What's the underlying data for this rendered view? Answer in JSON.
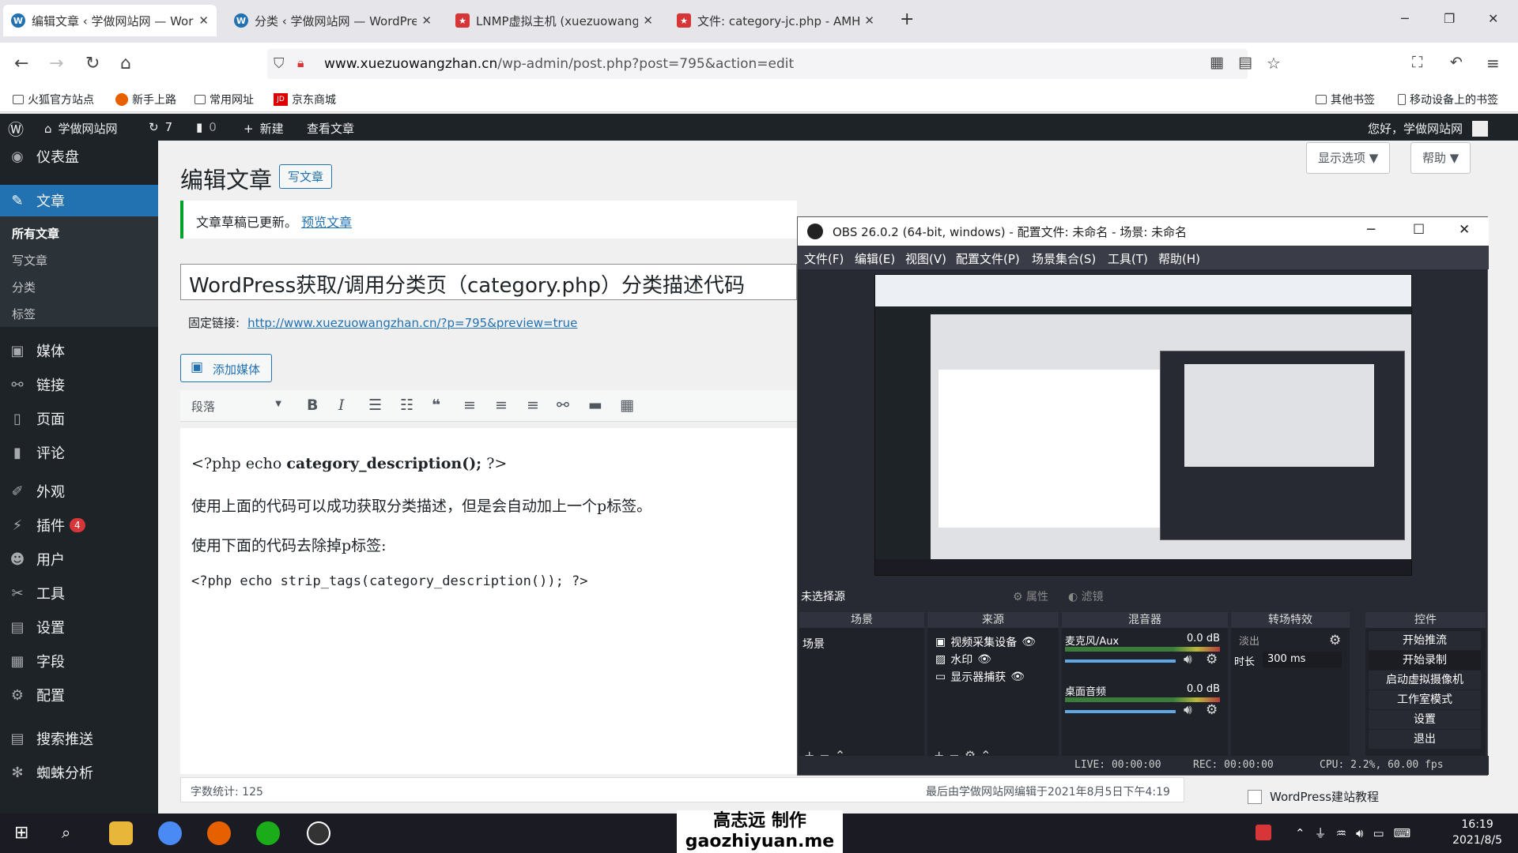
{
  "browser": {
    "tabs": [
      {
        "title": "编辑文章 ‹ 学做网站网 — Wor",
        "favicon": "wordpress-icon",
        "color": "#2271b1"
      },
      {
        "title": "分类 ‹ 学做网站网 — WordPre",
        "favicon": "wordpress-icon",
        "color": "#2271b1"
      },
      {
        "title": "LNMP虚拟主机 (xuezuowang",
        "favicon": "star-icon",
        "color": "#d63638"
      },
      {
        "title": "文件: category-jc.php - AMH",
        "favicon": "star-icon",
        "color": "#d63638"
      }
    ],
    "new_tab": "+",
    "url_domain": "www.xuezuowangzhan.cn",
    "url_path": "/wp-admin/post.php?post=795&action=edit",
    "bookmarks": [
      "火狐官方站点",
      "新手上路",
      "常用网址",
      "京东商城"
    ],
    "bookmarks_right": [
      "其他书签",
      "移动设备上的书签"
    ]
  },
  "adminbar": {
    "site_name": "学做网站网",
    "updates": "7",
    "comments": "0",
    "new_label": "新建",
    "view_post": "查看文章",
    "greeting": "您好，学做网站网"
  },
  "sidebar": {
    "items": [
      {
        "label": "仪表盘",
        "icon": "dashboard-icon"
      },
      {
        "label": "文章",
        "icon": "pin-icon"
      },
      {
        "label": "媒体",
        "icon": "media-icon"
      },
      {
        "label": "链接",
        "icon": "link-icon"
      },
      {
        "label": "页面",
        "icon": "page-icon"
      },
      {
        "label": "评论",
        "icon": "comment-icon"
      },
      {
        "label": "外观",
        "icon": "brush-icon"
      },
      {
        "label": "插件",
        "icon": "plugin-icon",
        "badge": "4"
      },
      {
        "label": "用户",
        "icon": "user-icon"
      },
      {
        "label": "工具",
        "icon": "tool-icon"
      },
      {
        "label": "设置",
        "icon": "settings-icon"
      },
      {
        "label": "字段",
        "icon": "field-icon"
      },
      {
        "label": "配置",
        "icon": "gear-icon"
      },
      {
        "label": "搜索推送",
        "icon": "search-push-icon"
      },
      {
        "label": "蜘蛛分析",
        "icon": "spider-icon"
      }
    ],
    "subitems": [
      "所有文章",
      "写文章",
      "分类",
      "标签"
    ]
  },
  "main": {
    "heading": "编辑文章",
    "add_new": "写文章",
    "screen_options": "显示选项 ▼",
    "help": "帮助 ▼",
    "notice_text": "文章草稿已更新。",
    "notice_link": "预览文章",
    "post_title": "WordPress获取/调用分类页（category.php）分类描述代码",
    "permalink_label": "固定链接:",
    "permalink_url": "http://www.xuezuowangzhan.cn/?p=795&preview=true",
    "add_media": "添加媒体",
    "format_select": "段落",
    "content": {
      "line1_pre": "<?php echo ",
      "line1_bold": "category_description();",
      "line1_post": " ?>",
      "line2": "使用上面的代码可以成功获取分类描述，但是会自动加上一个p标签。",
      "line3": "使用下面的代码去除掉p标签:",
      "line4": "<?php echo strip_tags(category_description()); ?>"
    },
    "word_count": "字数统计: 125",
    "last_edited": "最后由学做网站网编辑于2021年8月5日下午4:19",
    "category_checkbox": "WordPress建站教程"
  },
  "obs": {
    "title": "OBS 26.0.2 (64-bit, windows) - 配置文件: 未命名 - 场景: 未命名",
    "menu": [
      "文件(F)",
      "编辑(E)",
      "视图(V)",
      "配置文件(P)",
      "场景集合(S)",
      "工具(T)",
      "帮助(H)"
    ],
    "no_source": "未选择源",
    "properties": "属性",
    "filters": "滤镜",
    "panels": {
      "scenes": "场景",
      "sources": "来源",
      "mixer": "混音器",
      "transitions": "转场特效",
      "controls": "控件"
    },
    "scene_item": "场景",
    "sources": [
      "视频采集设备",
      "水印",
      "显示器捕获"
    ],
    "mixer": [
      {
        "name": "麦克风/Aux",
        "level": "0.0 dB"
      },
      {
        "name": "桌面音频",
        "level": "0.0 dB"
      }
    ],
    "transition": "淡出",
    "duration_label": "时长",
    "duration_value": "300 ms",
    "controls": [
      "开始推流",
      "开始录制",
      "启动虚拟摄像机",
      "工作室模式",
      "设置",
      "退出"
    ],
    "status": {
      "live": "LIVE: 00:00:00",
      "rec": "REC: 00:00:00",
      "cpu": "CPU: 2.2%, 60.00 fps"
    }
  },
  "taskbar": {
    "watermark_line1": "高志远 制作",
    "watermark_line2": "gaozhiyuan.me",
    "time": "16:19",
    "date": "2021/8/5"
  }
}
